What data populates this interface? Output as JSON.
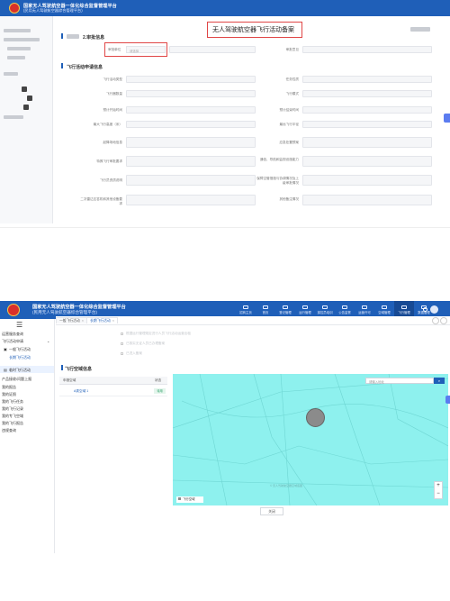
{
  "top": {
    "logo_line1": "国家无人驾驶航空器一体化综合监督管理平台",
    "logo_line2": "(民用无人驾驶航空器综合管理平台)",
    "callout": "无人驾驶航空器飞行活动备案",
    "section1_title": "2.审批信息",
    "hl_label": "审批单位",
    "hl_placeholder": "请选择",
    "approval_right_label": "审批意见",
    "section2_title": "飞行活动申请信息",
    "fields": [
      {
        "label": "飞行活动类型",
        "side": "left"
      },
      {
        "label": "任务性质",
        "side": "right"
      },
      {
        "label": "飞行器数量",
        "side": "left"
      },
      {
        "label": "飞行模式",
        "side": "right"
      },
      {
        "label": "预计开始时间",
        "side": "left"
      },
      {
        "label": "预计结束时间",
        "side": "right"
      },
      {
        "label": "最大飞行高度（米）",
        "side": "left"
      },
      {
        "label": "最远飞行半径",
        "side": "right"
      },
      {
        "label": "起降场地信息",
        "side": "left"
      },
      {
        "label": "应急处置预案",
        "side": "right"
      },
      {
        "label": "特殊飞行审批要求",
        "side": "left"
      },
      {
        "label": "通信、导航和监视设施能力",
        "side": "right"
      },
      {
        "label": "飞行员资质说明",
        "side": "left"
      },
      {
        "label": "保障空管措施与协调情况及上级审批情况",
        "side": "right"
      },
      {
        "label": "二次雷达应答机和其他设备要求",
        "side": "left"
      },
      {
        "label": "其他备注情况",
        "side": "right"
      }
    ]
  },
  "bottom": {
    "logo_line1": "国家无人驾驶航空器一体化综合监督管理平台",
    "logo_line2": "(民用无人驾驶航空器综合管理平台)",
    "top_nav": [
      {
        "label": "招商主页",
        "icon": "home-icon"
      },
      {
        "label": "首页",
        "icon": "monitor-icon"
      },
      {
        "label": "登记管理",
        "icon": "register-icon"
      },
      {
        "label": "运行管理",
        "icon": "ops-icon"
      },
      {
        "label": "操控员培训",
        "icon": "training-icon"
      },
      {
        "label": "公告监督",
        "icon": "notice-icon"
      },
      {
        "label": "运营许可",
        "icon": "license-icon"
      },
      {
        "label": "空域管理",
        "icon": "airspace-icon"
      },
      {
        "label": "飞行管理",
        "icon": "flight-icon",
        "active": true
      },
      {
        "label": "数据管理",
        "icon": "data-icon"
      }
    ],
    "menu": [
      {
        "label": "运营服务查询"
      },
      {
        "label": "飞行活动申请"
      },
      {
        "label": "一般飞行活动"
      },
      {
        "label": "长期飞行活动",
        "active": true
      },
      {
        "label": "临时飞行活动"
      },
      {
        "label": "产品接收/问题上报"
      },
      {
        "label": "我的报告"
      },
      {
        "label": "我的证照"
      },
      {
        "label": "我的飞行任务"
      },
      {
        "label": "我的飞行记录"
      },
      {
        "label": "我的专飞空域"
      },
      {
        "label": "我的飞行报告"
      },
      {
        "label": "违规查询"
      }
    ],
    "tabs": [
      {
        "label": "一般飞行活动",
        "active": false
      },
      {
        "label": "长期飞行活动",
        "active": true
      }
    ],
    "faded_options": [
      "根据运行管理规定进行人员飞行活动运营出租",
      "已核实无证人员已办理备案",
      "已进入备案"
    ],
    "section_title": "飞行空域信息",
    "plan_header": "申报空域",
    "plan_status_header": "状态",
    "plan_row_name": "A类空域 1",
    "plan_row_status": "待用",
    "map_search_placeholder": "请输入地址",
    "map_legend": "飞行空域",
    "map_attrib": "© 无人驾驶航空器空域底图",
    "zoom_in": "+",
    "zoom_out": "−",
    "footer_button": "关闭"
  }
}
